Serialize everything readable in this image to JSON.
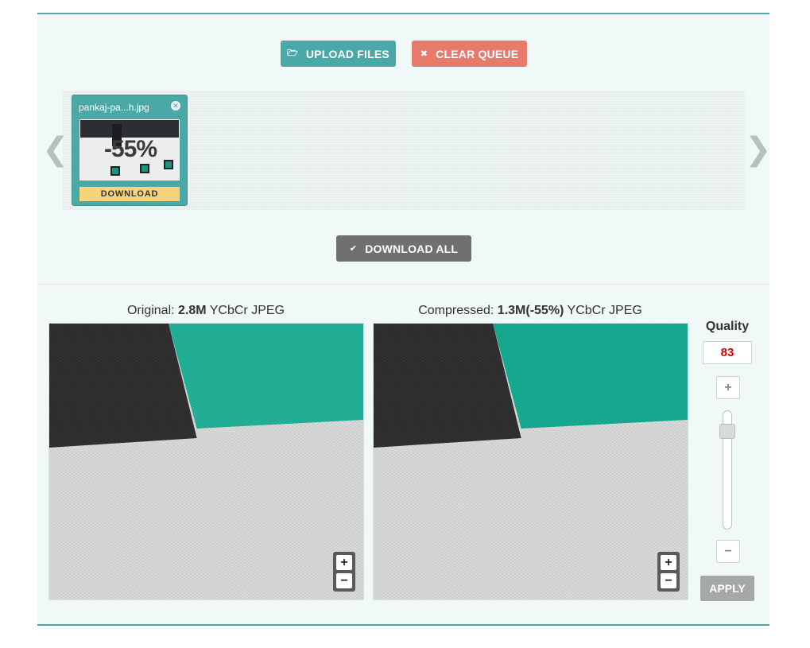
{
  "toolbar": {
    "upload_label": "UPLOAD FILES",
    "clear_label": "CLEAR QUEUE",
    "download_all_label": "DOWNLOAD ALL"
  },
  "queue": {
    "items": [
      {
        "filename": "pankaj-pa...h.jpg",
        "thumb_percent": "-55%",
        "download_label": "DOWNLOAD"
      }
    ]
  },
  "comparison": {
    "original": {
      "prefix": "Original: ",
      "size": "2.8M",
      "format": " YCbCr JPEG"
    },
    "compressed": {
      "prefix": "Compressed: ",
      "size": "1.3M(-55%)",
      "format": " YCbCr JPEG"
    }
  },
  "quality": {
    "label": "Quality",
    "value": "83",
    "plus_label": "+",
    "minus_label": "−",
    "apply_label": "APPLY"
  },
  "zoom": {
    "plus": "+",
    "minus": "−"
  },
  "colors": {
    "teal": "#4aa9a6",
    "salmon": "#e67b6b",
    "gray_button": "#6f7070",
    "download_yellow": "#f7d37c",
    "quality_value": "#d40000"
  }
}
